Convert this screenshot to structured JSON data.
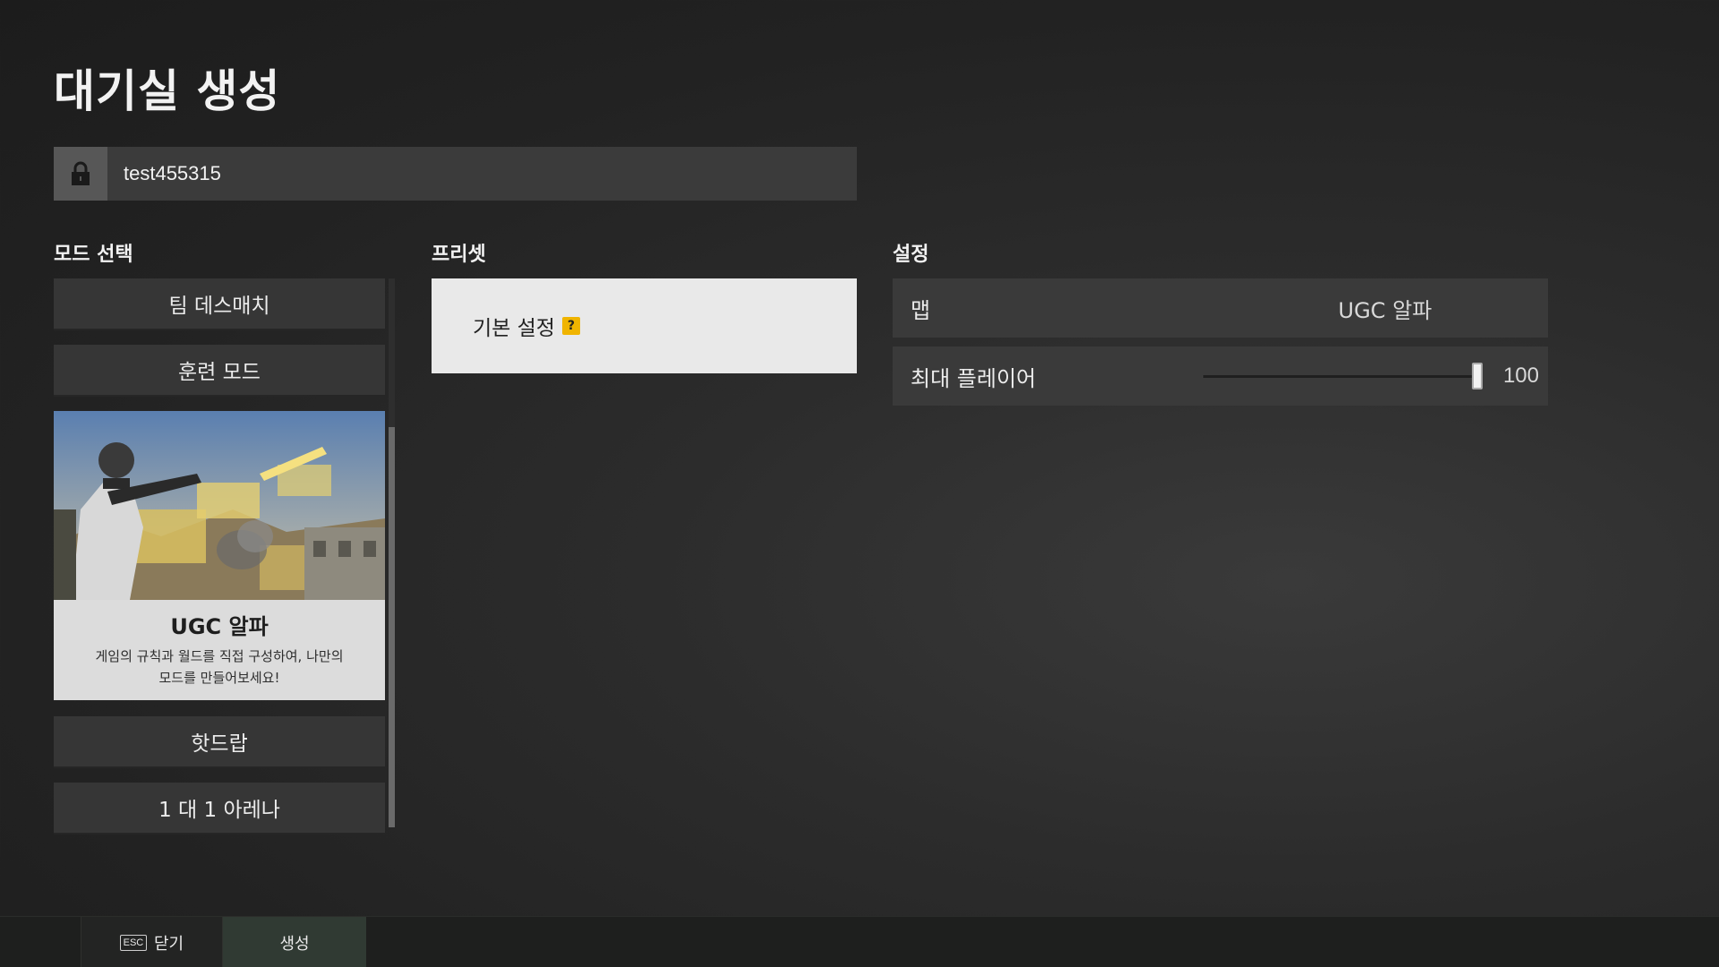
{
  "page": {
    "title": "대기실 생성"
  },
  "room": {
    "name": "test455315",
    "icon": "lock-icon"
  },
  "sections": {
    "mode_select": "모드 선택",
    "preset": "프리셋",
    "settings": "설정"
  },
  "modes": {
    "items": [
      {
        "label": "팀 데스매치"
      },
      {
        "label": "훈련 모드"
      },
      {
        "label": "UGC 알파",
        "selected": true,
        "description_line1": "게임의 규칙과 월드를 직접 구성하여, 나만의",
        "description_line2": "모드를 만들어보세요!"
      },
      {
        "label": "핫드랍"
      },
      {
        "label": "1 대 1 아레나"
      }
    ]
  },
  "preset": {
    "label": "기본 설정",
    "help": "?",
    "help_color": "#f0b400"
  },
  "settings": {
    "map": {
      "label": "맵",
      "value": "UGC 알파"
    },
    "max_players": {
      "label": "최대 플레이어",
      "value": "100",
      "level": 1.0
    }
  },
  "footer": {
    "close_key": "ESC",
    "close_label": "닫기",
    "create_label": "생성"
  }
}
